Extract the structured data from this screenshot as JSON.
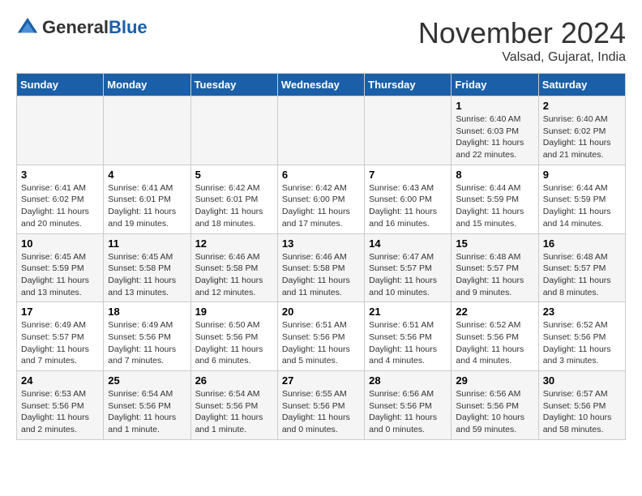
{
  "header": {
    "logo_line1": "General",
    "logo_line2": "Blue",
    "month_title": "November 2024",
    "location": "Valsad, Gujarat, India"
  },
  "days_of_week": [
    "Sunday",
    "Monday",
    "Tuesday",
    "Wednesday",
    "Thursday",
    "Friday",
    "Saturday"
  ],
  "weeks": [
    [
      {
        "day": "",
        "info": ""
      },
      {
        "day": "",
        "info": ""
      },
      {
        "day": "",
        "info": ""
      },
      {
        "day": "",
        "info": ""
      },
      {
        "day": "",
        "info": ""
      },
      {
        "day": "1",
        "info": "Sunrise: 6:40 AM\nSunset: 6:03 PM\nDaylight: 11 hours\nand 22 minutes."
      },
      {
        "day": "2",
        "info": "Sunrise: 6:40 AM\nSunset: 6:02 PM\nDaylight: 11 hours\nand 21 minutes."
      }
    ],
    [
      {
        "day": "3",
        "info": "Sunrise: 6:41 AM\nSunset: 6:02 PM\nDaylight: 11 hours\nand 20 minutes."
      },
      {
        "day": "4",
        "info": "Sunrise: 6:41 AM\nSunset: 6:01 PM\nDaylight: 11 hours\nand 19 minutes."
      },
      {
        "day": "5",
        "info": "Sunrise: 6:42 AM\nSunset: 6:01 PM\nDaylight: 11 hours\nand 18 minutes."
      },
      {
        "day": "6",
        "info": "Sunrise: 6:42 AM\nSunset: 6:00 PM\nDaylight: 11 hours\nand 17 minutes."
      },
      {
        "day": "7",
        "info": "Sunrise: 6:43 AM\nSunset: 6:00 PM\nDaylight: 11 hours\nand 16 minutes."
      },
      {
        "day": "8",
        "info": "Sunrise: 6:44 AM\nSunset: 5:59 PM\nDaylight: 11 hours\nand 15 minutes."
      },
      {
        "day": "9",
        "info": "Sunrise: 6:44 AM\nSunset: 5:59 PM\nDaylight: 11 hours\nand 14 minutes."
      }
    ],
    [
      {
        "day": "10",
        "info": "Sunrise: 6:45 AM\nSunset: 5:59 PM\nDaylight: 11 hours\nand 13 minutes."
      },
      {
        "day": "11",
        "info": "Sunrise: 6:45 AM\nSunset: 5:58 PM\nDaylight: 11 hours\nand 13 minutes."
      },
      {
        "day": "12",
        "info": "Sunrise: 6:46 AM\nSunset: 5:58 PM\nDaylight: 11 hours\nand 12 minutes."
      },
      {
        "day": "13",
        "info": "Sunrise: 6:46 AM\nSunset: 5:58 PM\nDaylight: 11 hours\nand 11 minutes."
      },
      {
        "day": "14",
        "info": "Sunrise: 6:47 AM\nSunset: 5:57 PM\nDaylight: 11 hours\nand 10 minutes."
      },
      {
        "day": "15",
        "info": "Sunrise: 6:48 AM\nSunset: 5:57 PM\nDaylight: 11 hours\nand 9 minutes."
      },
      {
        "day": "16",
        "info": "Sunrise: 6:48 AM\nSunset: 5:57 PM\nDaylight: 11 hours\nand 8 minutes."
      }
    ],
    [
      {
        "day": "17",
        "info": "Sunrise: 6:49 AM\nSunset: 5:57 PM\nDaylight: 11 hours\nand 7 minutes."
      },
      {
        "day": "18",
        "info": "Sunrise: 6:49 AM\nSunset: 5:56 PM\nDaylight: 11 hours\nand 7 minutes."
      },
      {
        "day": "19",
        "info": "Sunrise: 6:50 AM\nSunset: 5:56 PM\nDaylight: 11 hours\nand 6 minutes."
      },
      {
        "day": "20",
        "info": "Sunrise: 6:51 AM\nSunset: 5:56 PM\nDaylight: 11 hours\nand 5 minutes."
      },
      {
        "day": "21",
        "info": "Sunrise: 6:51 AM\nSunset: 5:56 PM\nDaylight: 11 hours\nand 4 minutes."
      },
      {
        "day": "22",
        "info": "Sunrise: 6:52 AM\nSunset: 5:56 PM\nDaylight: 11 hours\nand 4 minutes."
      },
      {
        "day": "23",
        "info": "Sunrise: 6:52 AM\nSunset: 5:56 PM\nDaylight: 11 hours\nand 3 minutes."
      }
    ],
    [
      {
        "day": "24",
        "info": "Sunrise: 6:53 AM\nSunset: 5:56 PM\nDaylight: 11 hours\nand 2 minutes."
      },
      {
        "day": "25",
        "info": "Sunrise: 6:54 AM\nSunset: 5:56 PM\nDaylight: 11 hours\nand 1 minute."
      },
      {
        "day": "26",
        "info": "Sunrise: 6:54 AM\nSunset: 5:56 PM\nDaylight: 11 hours\nand 1 minute."
      },
      {
        "day": "27",
        "info": "Sunrise: 6:55 AM\nSunset: 5:56 PM\nDaylight: 11 hours\nand 0 minutes."
      },
      {
        "day": "28",
        "info": "Sunrise: 6:56 AM\nSunset: 5:56 PM\nDaylight: 11 hours\nand 0 minutes."
      },
      {
        "day": "29",
        "info": "Sunrise: 6:56 AM\nSunset: 5:56 PM\nDaylight: 10 hours\nand 59 minutes."
      },
      {
        "day": "30",
        "info": "Sunrise: 6:57 AM\nSunset: 5:56 PM\nDaylight: 10 hours\nand 58 minutes."
      }
    ]
  ]
}
